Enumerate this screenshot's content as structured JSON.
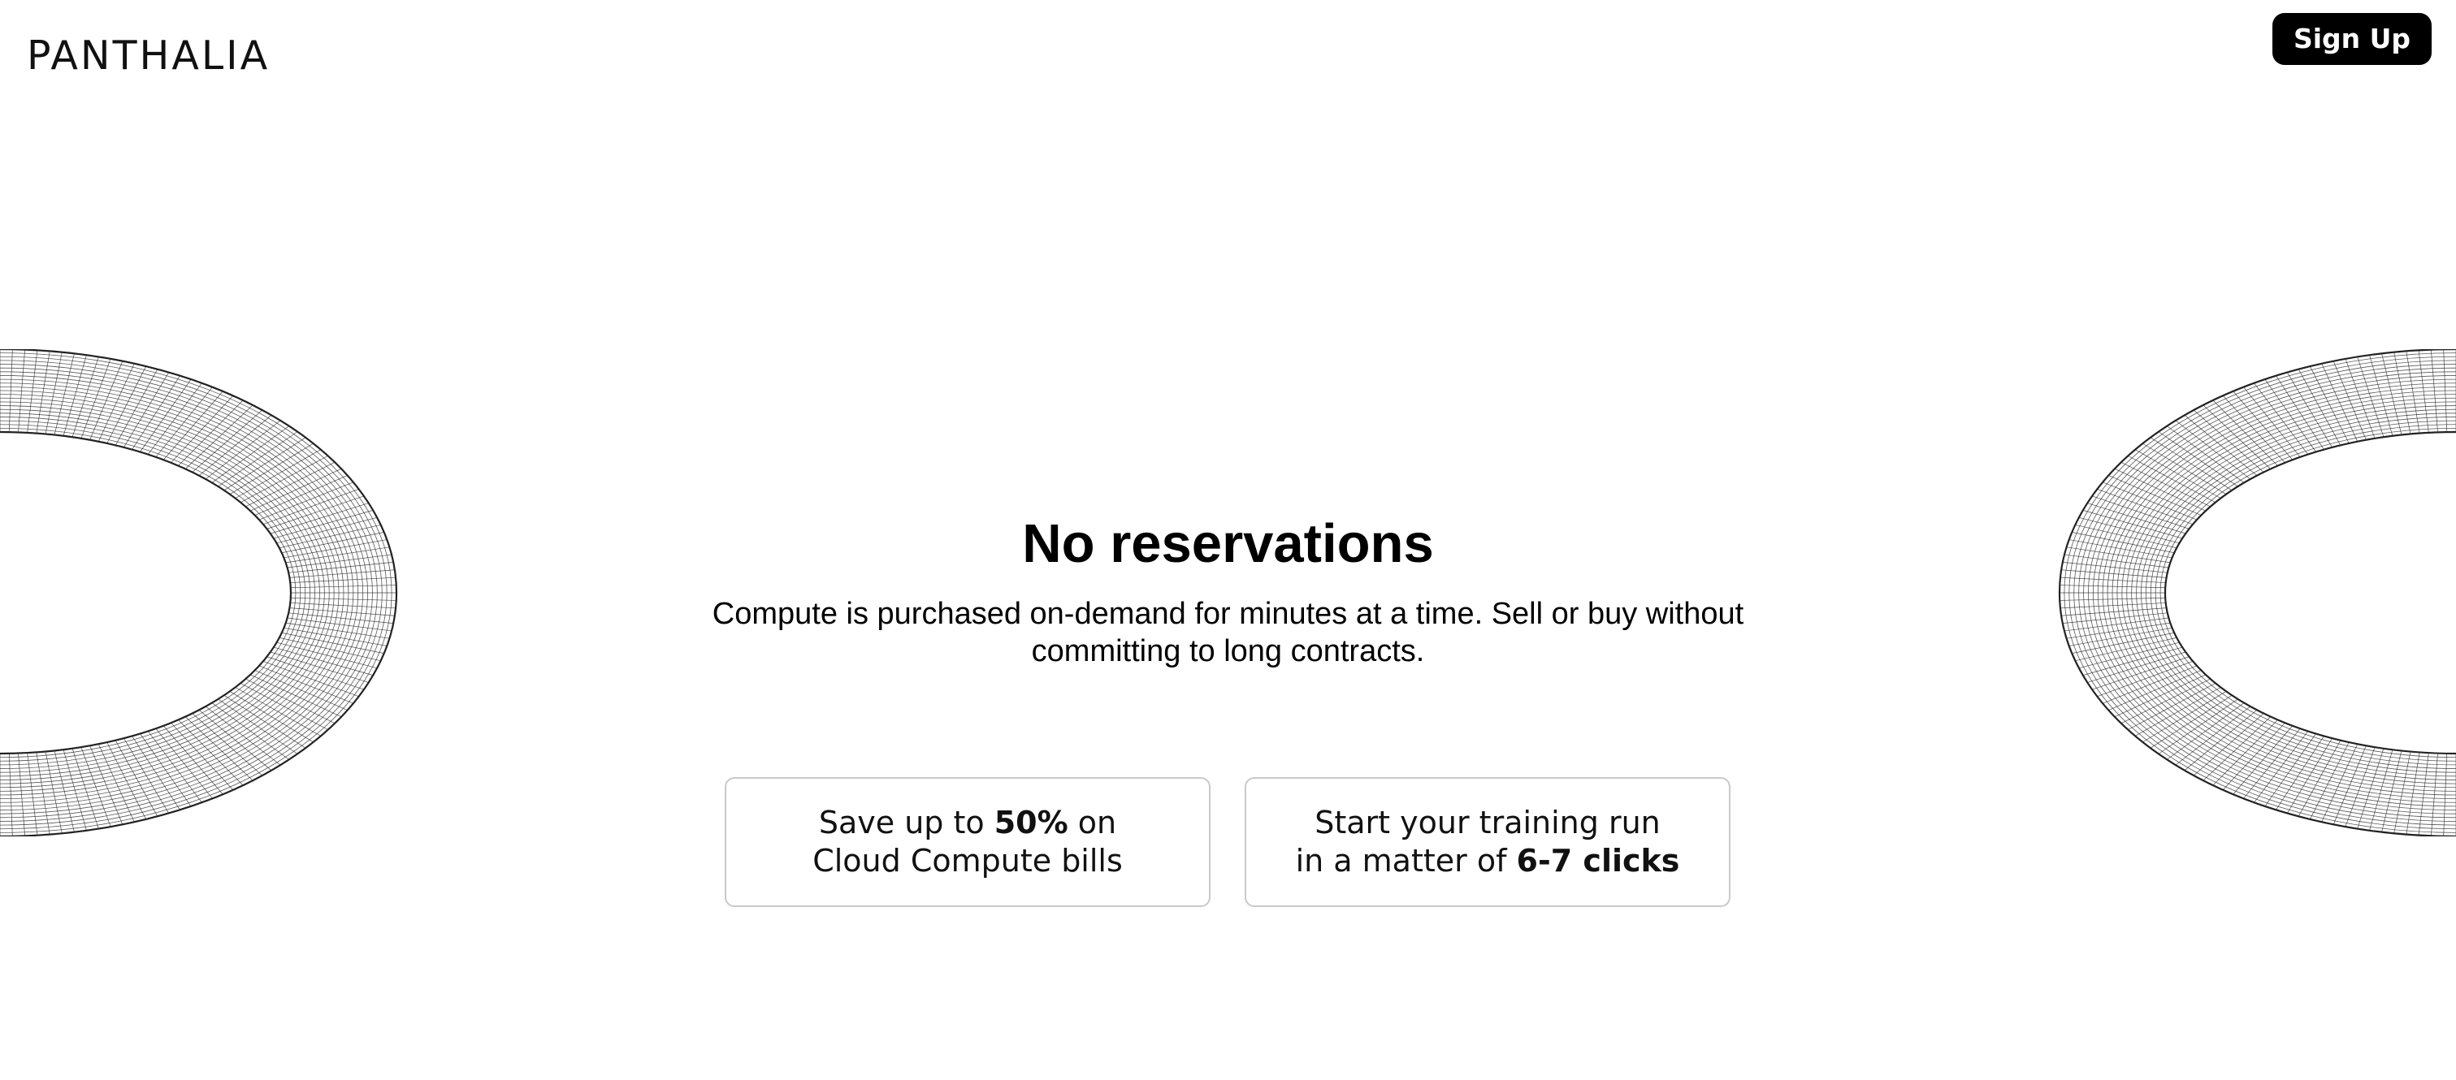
{
  "header": {
    "logo_text": "PANTHALIA",
    "signup_label": "Sign Up"
  },
  "hero": {
    "title": "No reservations",
    "subtitle": "Compute is purchased on-demand for minutes at a time. Sell or buy without committing to long contracts."
  },
  "cards": [
    {
      "line1_pre": "Save up to ",
      "line1_bold": "50%",
      "line1_post": " on",
      "line2_pre": "Cloud Compute bills",
      "line2_bold": ""
    },
    {
      "line1_pre": "Start your training run",
      "line1_bold": "",
      "line1_post": "",
      "line2_pre": "in a matter of ",
      "line2_bold": "6-7 clicks"
    }
  ],
  "colors": {
    "background": "#ffffff",
    "button_bg": "#000000",
    "button_text": "#ffffff",
    "card_border": "#c9c9c9",
    "wireframe_stroke": "#222222"
  },
  "decorations": {
    "left_icon": "wireframe-torus-icon",
    "right_icon": "wireframe-torus-icon"
  }
}
